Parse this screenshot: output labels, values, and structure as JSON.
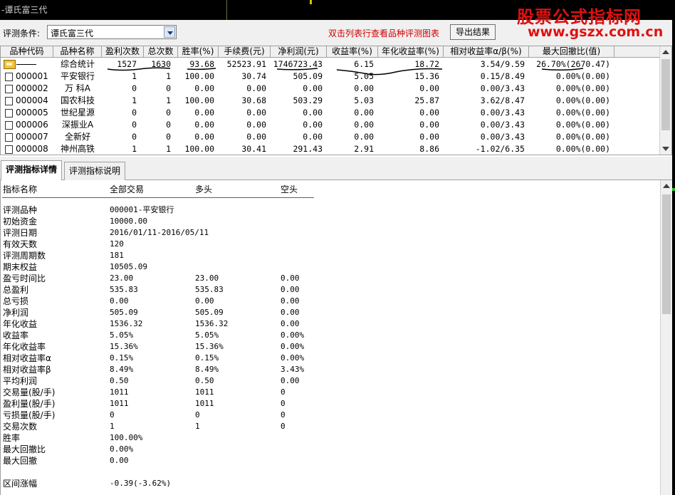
{
  "window": {
    "title": "-谭氏富三代"
  },
  "watermark": {
    "line1": "股票公式指标网",
    "line2": "www.gszx.com.cn"
  },
  "toolbar": {
    "condition_label": "评测条件:",
    "condition_value": "谭氏富三代",
    "hint": "双击列表行查看品种评测图表",
    "export_label": "导出结果"
  },
  "table": {
    "columns": [
      "品种代码",
      "品种名称",
      "盈利次数",
      "总次数",
      "胜率(%)",
      "手续费(元)",
      "净利润(元)",
      "收益率(%)",
      "年化收益率(%)",
      "相对收益率α/β(%)",
      "最大回撤比(值)"
    ],
    "rows": [
      [
        "",
        "综合统计",
        "1527",
        "1630",
        "93.68",
        "52523.91",
        "1746723.43",
        "6.15",
        "18.72",
        "3.54/9.59",
        "26.70%(2670.47)"
      ],
      [
        "000001",
        "平安银行",
        "1",
        "1",
        "100.00",
        "30.74",
        "505.09",
        "5.05",
        "15.36",
        "0.15/8.49",
        "0.00%(0.00)"
      ],
      [
        "000002",
        "万  科A",
        "0",
        "0",
        "0.00",
        "0.00",
        "0.00",
        "0.00",
        "0.00",
        "0.00/3.43",
        "0.00%(0.00)"
      ],
      [
        "000004",
        "国农科技",
        "1",
        "1",
        "100.00",
        "30.68",
        "503.29",
        "5.03",
        "25.87",
        "3.62/8.47",
        "0.00%(0.00)"
      ],
      [
        "000005",
        "世纪星源",
        "0",
        "0",
        "0.00",
        "0.00",
        "0.00",
        "0.00",
        "0.00",
        "0.00/3.43",
        "0.00%(0.00)"
      ],
      [
        "000006",
        "深振业A",
        "0",
        "0",
        "0.00",
        "0.00",
        "0.00",
        "0.00",
        "0.00",
        "0.00/3.43",
        "0.00%(0.00)"
      ],
      [
        "000007",
        "全新好",
        "0",
        "0",
        "0.00",
        "0.00",
        "0.00",
        "0.00",
        "0.00",
        "0.00/3.43",
        "0.00%(0.00)"
      ],
      [
        "000008",
        "神州高铁",
        "1",
        "1",
        "100.00",
        "30.41",
        "291.43",
        "2.91",
        "8.86",
        "-1.02/6.35",
        "0.00%(0.00)"
      ]
    ]
  },
  "tabs": [
    {
      "label": "评测指标详情",
      "active": true
    },
    {
      "label": "评测指标说明",
      "active": false
    }
  ],
  "detail": {
    "headers": [
      "指标名称",
      "全部交易",
      "多头",
      "空头"
    ],
    "rows": [
      [
        "评测品种",
        "000001-平安银行",
        "",
        ""
      ],
      [
        "初始资金",
        "10000.00",
        "",
        ""
      ],
      [
        "评测日期",
        "2016/01/11-2016/05/11",
        "",
        ""
      ],
      [
        "有效天数",
        "120",
        "",
        ""
      ],
      [
        "评测周期数",
        "181",
        "",
        ""
      ],
      [
        "期末权益",
        "10505.09",
        "",
        ""
      ],
      [
        "盈亏时间比",
        "23.00",
        "23.00",
        "0.00"
      ],
      [
        "总盈利",
        "535.83",
        "535.83",
        "0.00"
      ],
      [
        "总亏损",
        "0.00",
        "0.00",
        "0.00"
      ],
      [
        "净利润",
        "505.09",
        "505.09",
        "0.00"
      ],
      [
        "年化收益",
        "1536.32",
        "1536.32",
        "0.00"
      ],
      [
        "收益率",
        "5.05%",
        "5.05%",
        "0.00%"
      ],
      [
        "年化收益率",
        "15.36%",
        "15.36%",
        "0.00%"
      ],
      [
        "相对收益率α",
        "0.15%",
        "0.15%",
        "0.00%"
      ],
      [
        "相对收益率β",
        "8.49%",
        "8.49%",
        "3.43%"
      ],
      [
        "平均利润",
        "0.50",
        "0.50",
        "0.00"
      ],
      [
        "交易量(股/手)",
        "1011",
        "1011",
        "0"
      ],
      [
        "盈利量(股/手)",
        "1011",
        "1011",
        "0"
      ],
      [
        "亏损量(股/手)",
        "0",
        "0",
        "0"
      ],
      [
        "交易次数",
        "1",
        "1",
        "0"
      ],
      [
        "胜率",
        "100.00%",
        "",
        ""
      ],
      [
        "最大回撤比",
        "0.00%",
        "",
        ""
      ],
      [
        "最大回撤",
        "0.00",
        "",
        ""
      ],
      [
        "",
        "",
        "",
        ""
      ],
      [
        "区间涨幅",
        "-0.39(-3.62%)",
        "",
        ""
      ]
    ]
  }
}
